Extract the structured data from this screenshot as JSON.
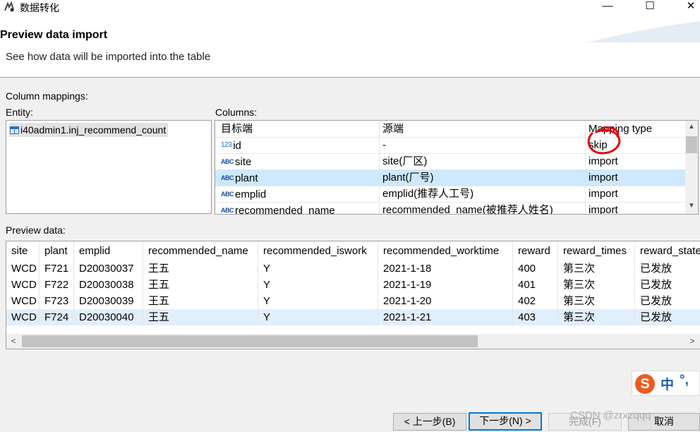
{
  "window": {
    "title": "数据转化",
    "controls": {
      "minimize": "—",
      "maximize": "☐",
      "close": "✕"
    }
  },
  "header": {
    "title": "Preview data import",
    "description": "See how data will be imported into the table"
  },
  "mappings": {
    "section_label": "Column mappings:",
    "entity_label": "Entity:",
    "columns_label": "Columns:"
  },
  "entity": {
    "name": "i40admin1.inj_recommend_count"
  },
  "columns": {
    "headers": [
      "目标端",
      "源端",
      "Mapping type"
    ],
    "rows": [
      {
        "icon": "123",
        "target": "id",
        "source": "-",
        "mapping": "skip"
      },
      {
        "icon": "ABC",
        "target": "site",
        "source": "site(厂区)",
        "mapping": "import"
      },
      {
        "icon": "ABC",
        "target": "plant",
        "source": "plant(厂号)",
        "mapping": "import"
      },
      {
        "icon": "ABC",
        "target": "emplid",
        "source": "emplid(推荐人工号)",
        "mapping": "import"
      },
      {
        "icon": "ABC",
        "target": "recommended_name",
        "source": "recommended_name(被推荐人姓名)",
        "mapping": "import"
      }
    ]
  },
  "preview": {
    "label": "Preview data:",
    "headers": [
      "site",
      "plant",
      "emplid",
      "recommended_name",
      "recommended_iswork",
      "recommended_worktime",
      "reward",
      "reward_times",
      "reward_state"
    ],
    "rows": [
      [
        "WCD",
        "F721",
        "D20030037",
        "王五",
        "Y",
        "2021-1-18",
        "400",
        "第三次",
        "已发放"
      ],
      [
        "WCD",
        "F722",
        "D20030038",
        "王五",
        "Y",
        "2021-1-19",
        "401",
        "第三次",
        "已发放"
      ],
      [
        "WCD",
        "F723",
        "D20030039",
        "王五",
        "Y",
        "2021-1-20",
        "402",
        "第三次",
        "已发放"
      ],
      [
        "WCD",
        "F724",
        "D20030040",
        "王五",
        "Y",
        "2021-1-21",
        "403",
        "第三次",
        "已发放"
      ]
    ]
  },
  "buttons": {
    "back": "< 上一步(B)",
    "next": "下一步(N) >",
    "finish": "完成(F)",
    "cancel": "取消"
  },
  "ime": {
    "logo": "S",
    "lang": "中",
    "punct": "°,"
  },
  "watermark": "CSDN @zrxzqqq"
}
